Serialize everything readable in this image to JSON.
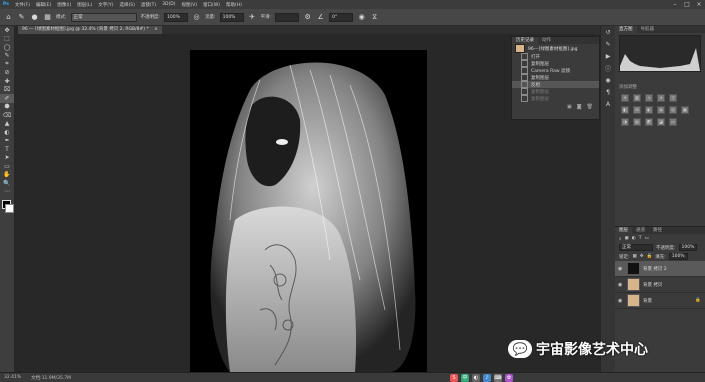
{
  "menubar": {
    "items": [
      "文件(F)",
      "编辑(E)",
      "图像(I)",
      "图层(L)",
      "文字(Y)",
      "选择(S)",
      "滤镜(T)",
      "3D(D)",
      "视图(V)",
      "窗口(W)",
      "帮助(H)"
    ],
    "min": "–",
    "max": "□",
    "close": "×"
  },
  "options": {
    "mode_label": "模式:",
    "mode_value": "正常",
    "opacity_label": "不透明度:",
    "opacity_value": "100%",
    "flow_label": "流量:",
    "flow_value": "100%",
    "smooth_label": "平滑:",
    "angle_value": "0°"
  },
  "tab": {
    "title": "96 — [绿图素材抠图].jpg @ 32.4% (背景 拷贝 2, RGB/8#) *",
    "close": "×"
  },
  "tools": [
    "✥",
    "⬚",
    "◯",
    "✎",
    "⌗",
    "⊘",
    "✚",
    "⌧",
    "✐",
    "⬢",
    "⌫",
    "▲",
    "◐",
    "✒",
    "T",
    "➤",
    "▭",
    "✋",
    "🔍",
    "⋯"
  ],
  "history": {
    "tabs": [
      "历史记录",
      "动作"
    ],
    "snapshot": "96---[绿图素材抠图].jpg",
    "items": [
      {
        "label": "打开",
        "state": "normal"
      },
      {
        "label": "复制图层",
        "state": "normal"
      },
      {
        "label": "Camera Raw 滤镜",
        "state": "normal"
      },
      {
        "label": "复制图层",
        "state": "normal"
      },
      {
        "label": "反相",
        "state": "active"
      },
      {
        "label": "复制图层",
        "state": "dim"
      },
      {
        "label": "复制图层",
        "state": "dim"
      }
    ]
  },
  "rightpanel": {
    "tabs": [
      "直方图",
      "导航器"
    ],
    "adjust_title": "添加调整"
  },
  "layers": {
    "tabs": [
      "图层",
      "通道",
      "路径"
    ],
    "blend": "正常",
    "opacity_label": "不透明度:",
    "opacity_value": "100%",
    "lock_label": "锁定:",
    "fill_label": "填充:",
    "fill_value": "100%",
    "items": [
      {
        "name": "背景 拷贝 2",
        "active": true,
        "thumb": "dark"
      },
      {
        "name": "背景 拷贝",
        "active": false,
        "thumb": "photo"
      },
      {
        "name": "背景",
        "active": false,
        "thumb": "photo"
      }
    ]
  },
  "status": {
    "zoom": "32.41%",
    "doc": "文档:11.9M/35.7M"
  },
  "watermark": {
    "text": "宇宙影像艺术中心",
    "icon": "wechat-icon"
  }
}
